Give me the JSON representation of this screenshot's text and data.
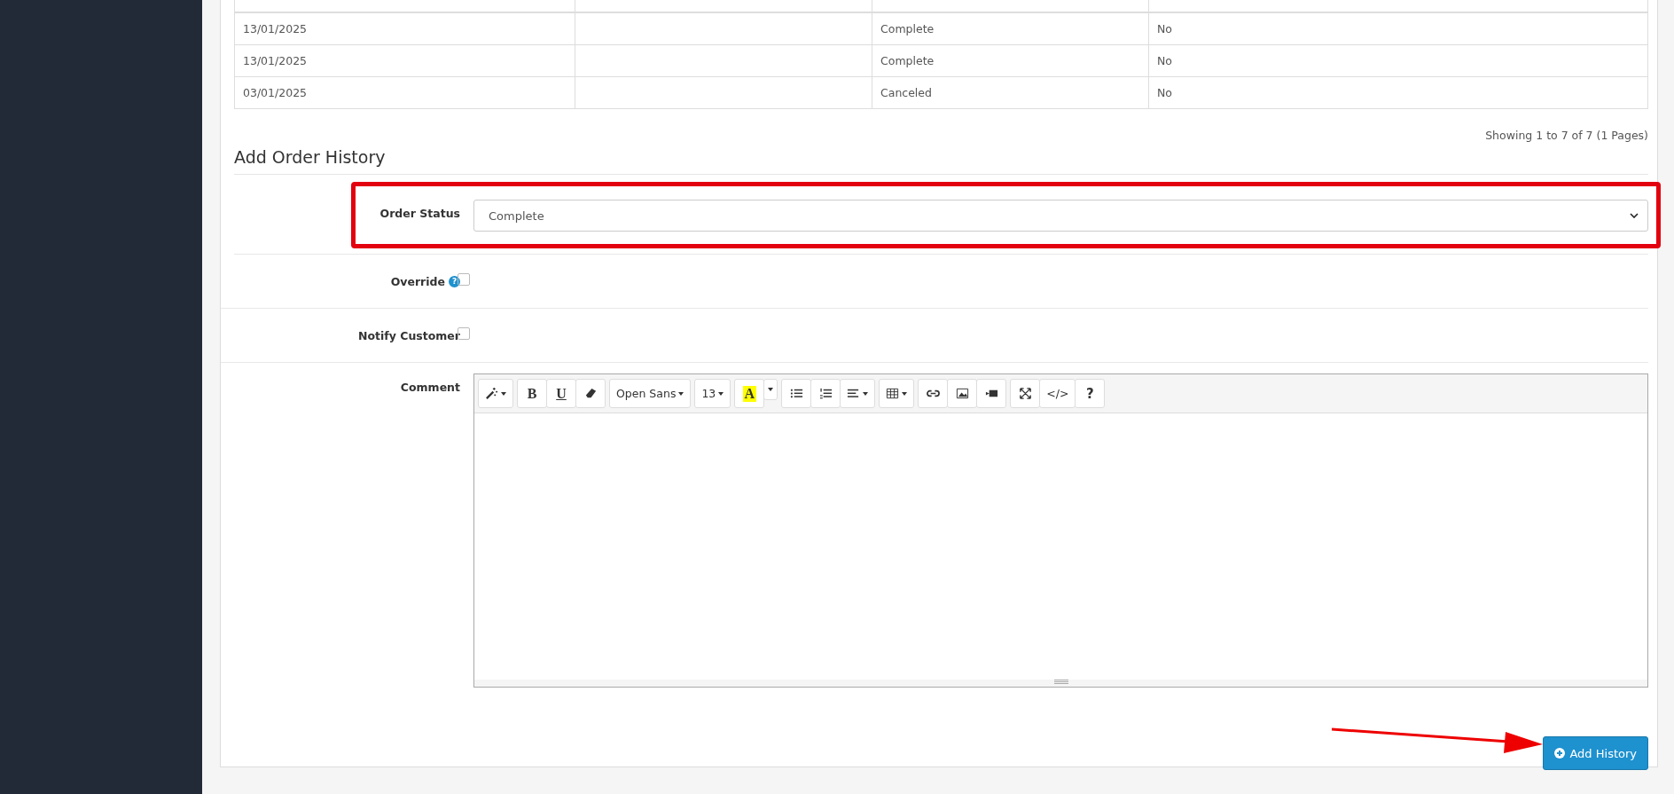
{
  "history_table": {
    "rows": [
      [
        "13/01/2025",
        "",
        "Complete",
        "No"
      ],
      [
        "13/01/2025",
        "",
        "Complete",
        "No"
      ],
      [
        "03/01/2025",
        "",
        "Canceled",
        "No"
      ]
    ],
    "pagination": "Showing 1 to 7 of 7 (1 Pages)"
  },
  "form": {
    "title": "Add Order History",
    "fields": [
      {
        "kind": "select",
        "label": "Order Status",
        "value": "Complete",
        "highlighted": true
      },
      {
        "kind": "checkbox",
        "label": "Override",
        "help": "?",
        "checked": false
      },
      {
        "kind": "checkbox",
        "label": "Notify Customer",
        "checked": false
      },
      {
        "kind": "editor",
        "label": "Comment"
      }
    ],
    "toolbar": [
      [
        {
          "kind": "magic",
          "caret": true
        }
      ],
      [
        {
          "kind": "bold",
          "label": "B"
        },
        {
          "kind": "underline",
          "label": "U"
        },
        {
          "kind": "eraser"
        }
      ],
      [
        {
          "kind": "font",
          "label": "Open Sans",
          "caret": true
        }
      ],
      [
        {
          "kind": "size",
          "label": "13",
          "caret": true
        }
      ],
      [
        {
          "kind": "color",
          "label": "A"
        },
        {
          "kind": "caret",
          "caret": true
        }
      ],
      [
        {
          "kind": "ul"
        },
        {
          "kind": "ol"
        },
        {
          "kind": "align",
          "caret": true
        }
      ],
      [
        {
          "kind": "table",
          "caret": true
        }
      ],
      [
        {
          "kind": "link"
        },
        {
          "kind": "picture"
        },
        {
          "kind": "video"
        }
      ],
      [
        {
          "kind": "fullscreen"
        },
        {
          "kind": "code",
          "label": "</>"
        },
        {
          "kind": "help",
          "label": "?"
        }
      ]
    ],
    "submit": {
      "label": "Add History",
      "annotated": true
    }
  }
}
